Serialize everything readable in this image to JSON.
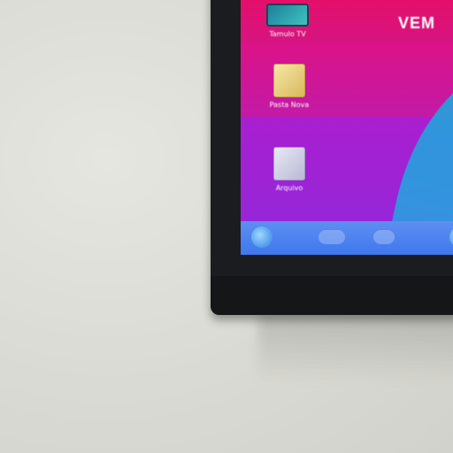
{
  "screen": {
    "headline": "VEM",
    "icons": [
      {
        "id": "tv",
        "label": "Tamulo TV",
        "icon": "tv-icon"
      },
      {
        "id": "folder",
        "label": "Pasta Nova",
        "icon": "folder-icon"
      },
      {
        "id": "doc",
        "label": "Arquivo",
        "icon": "document-icon"
      }
    ]
  },
  "colors": {
    "wall": "#dcdbd6",
    "bezel": "#1b1c1f",
    "screen_primary": "#e8147d",
    "screen_secondary": "#9a22d6",
    "accent_blue": "#1aa6d8",
    "taskbar": "#3f78ee"
  }
}
